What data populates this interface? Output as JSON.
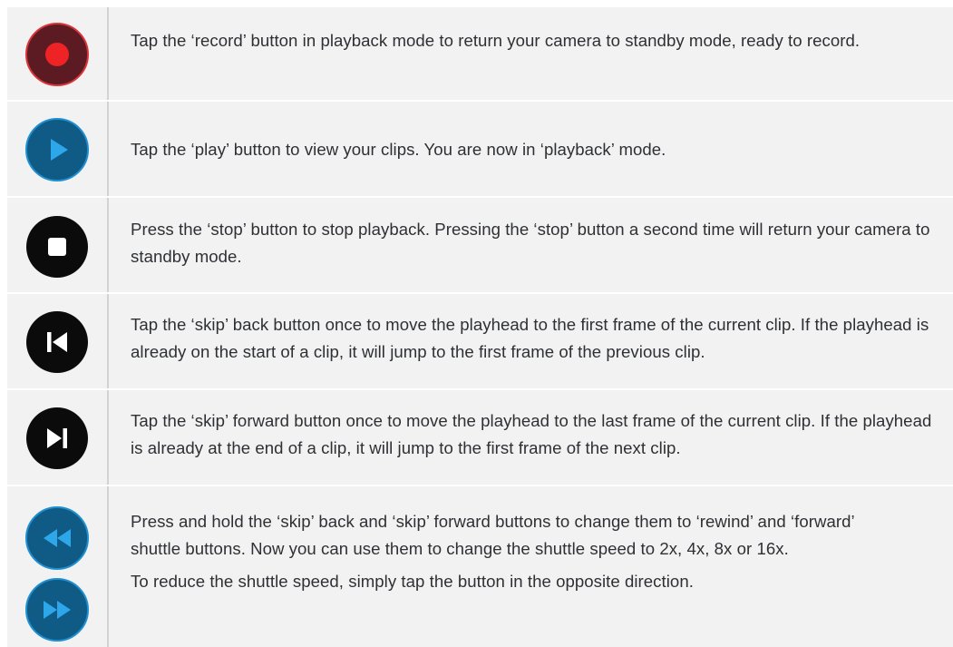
{
  "rows": [
    {
      "button": "record",
      "icon": "record-icon",
      "paragraphs": [
        "Tap the ‘record’ button in playback mode to return your camera to standby mode, ready to record."
      ]
    },
    {
      "button": "play",
      "icon": "play-icon",
      "paragraphs": [
        "Tap the ‘play’ button to view your clips. You are now in ‘playback’ mode."
      ]
    },
    {
      "button": "stop",
      "icon": "stop-icon",
      "paragraphs": [
        "Press the ‘stop’ button to stop playback. Pressing the ‘stop’ button a second time will return your camera to standby mode."
      ]
    },
    {
      "button": "skip back",
      "icon": "skip-back-icon",
      "paragraphs": [
        "Tap the ‘skip’ back button once to move the playhead to the first frame of the current clip. If the playhead is already on the start of a clip, it will jump to the first frame of the previous clip."
      ]
    },
    {
      "button": "skip forward",
      "icon": "skip-forward-icon",
      "paragraphs": [
        "Tap the ‘skip’ forward button once to move the playhead to the last frame of the current clip. If the playhead is already at the end of a clip, it will jump to the first frame of the next clip."
      ]
    },
    {
      "button": "rewind / forward shuttle",
      "icons": [
        "rewind-icon",
        "fast-forward-icon"
      ],
      "paragraphs": [
        "Press and hold the ‘skip’ back and ‘skip’ forward buttons to change them to ‘rewind’ and ‘forward’ shuttle buttons. Now you can use them to change the shuttle speed to 2x, 4x, 8x or 16x.",
        "To reduce the shuttle speed, simply tap the button in the opposite direction."
      ]
    }
  ],
  "colors": {
    "row_background": "#f2f2f3",
    "divider": "#d2d3d6",
    "text": "#2e3033",
    "record_outer": "#5c1a22",
    "record_ring": "#d8353a",
    "record_dot": "#ee2326",
    "play_blue": "#0f5b85",
    "play_ring": "#1f8fd0",
    "play_arrow": "#2ea6ea",
    "black_button": "#0b0b0c"
  }
}
